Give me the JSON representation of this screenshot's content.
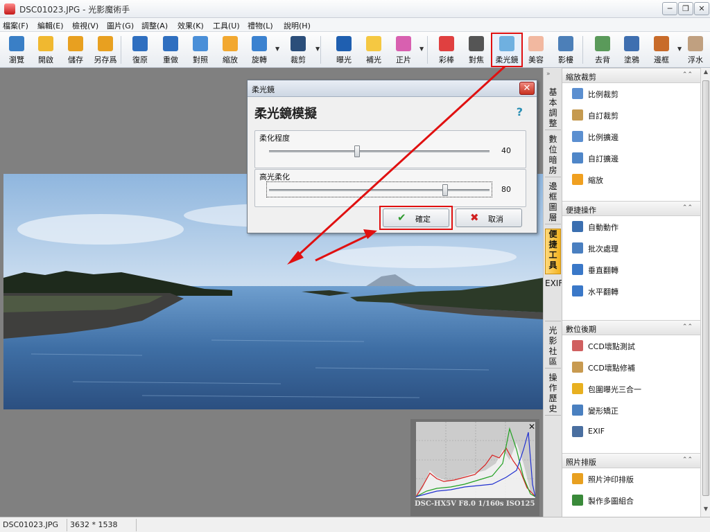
{
  "window": {
    "title": "DSC01023.JPG - 光影魔術手",
    "controls": {
      "minimize": "─",
      "maximize": "❐",
      "close": "✕"
    }
  },
  "menubar": {
    "items": [
      {
        "label": "檔案(F)"
      },
      {
        "label": "編輯(E)"
      },
      {
        "label": "檢視(V)"
      },
      {
        "label": "圖片(G)"
      },
      {
        "label": "調整(A)"
      },
      {
        "label": "效果(K)"
      },
      {
        "label": "工具(U)"
      },
      {
        "label": "禮物(L)"
      },
      {
        "label": "說明(H)"
      }
    ]
  },
  "toolbar": {
    "tools": [
      {
        "label": "瀏覽",
        "icon": "eye-icon",
        "color": "#3a7fc6"
      },
      {
        "label": "開啟",
        "icon": "folder-icon",
        "color": "#f0b830"
      },
      {
        "label": "儲存",
        "icon": "save-icon",
        "color": "#e8a020"
      },
      {
        "label": "另存爲",
        "icon": "save-as-icon",
        "color": "#e8a020"
      },
      {
        "label": "復原",
        "icon": "undo-icon",
        "color": "#2f6fc0"
      },
      {
        "label": "重做",
        "icon": "redo-icon",
        "color": "#2f6fc0"
      },
      {
        "label": "對照",
        "icon": "compare-icon",
        "color": "#4a8fd8"
      },
      {
        "label": "縮放",
        "icon": "resize-icon",
        "color": "#f2a830"
      },
      {
        "label": "旋轉",
        "icon": "rotate-icon",
        "color": "#3b82d0"
      },
      {
        "label": "裁剪",
        "icon": "crop-icon",
        "color": "#2b4e7a"
      },
      {
        "label": "曝光",
        "icon": "exposure-icon",
        "color": "#1f5fb0"
      },
      {
        "label": "補光",
        "icon": "fill-light-icon",
        "color": "#f5c842"
      },
      {
        "label": "正片",
        "icon": "positive-film-icon",
        "color": "#d860b0"
      },
      {
        "label": "彩棒",
        "icon": "color-wand-icon",
        "color": "#e04040"
      },
      {
        "label": "對焦",
        "icon": "focus-icon",
        "color": "#555555"
      },
      {
        "label": "柔光鏡",
        "icon": "soft-focus-icon",
        "color": "#6fb0e0"
      },
      {
        "label": "美容",
        "icon": "beauty-icon",
        "color": "#f2b8a0"
      },
      {
        "label": "影樓",
        "icon": "studio-icon",
        "color": "#4c7fb8"
      },
      {
        "label": "去背",
        "icon": "remove-bg-icon",
        "color": "#5a9a5a"
      },
      {
        "label": "塗鴉",
        "icon": "doodle-icon",
        "color": "#3f6fb0"
      },
      {
        "label": "邊框",
        "icon": "border-icon",
        "color": "#c86b2a"
      },
      {
        "label": "浮水",
        "icon": "watermark-icon",
        "color": "#c0a080"
      }
    ]
  },
  "dialog": {
    "title": "柔光鏡",
    "close": "✕",
    "heading": "柔光鏡模擬",
    "help": "?",
    "sliders": [
      {
        "label": "柔化程度",
        "value": 40,
        "max": 100
      },
      {
        "label": "高光柔化",
        "value": 80,
        "max": 100
      }
    ],
    "ok_label": "確定",
    "ok_icon": "✔",
    "cancel_label": "取消",
    "cancel_icon": "✖"
  },
  "histogram": {
    "caption": "DSC-HX5V  F8.0  1/160s  ISO125",
    "close": "✕"
  },
  "dock_tabs": [
    {
      "label": "基本調整"
    },
    {
      "label": "數位暗房"
    },
    {
      "label": "邊框圖層"
    },
    {
      "label": "便捷工具"
    },
    {
      "label": "EXIF"
    },
    {
      "label": "光影社區"
    },
    {
      "label": "操作歷史"
    }
  ],
  "dock_grip": "»",
  "panel": {
    "sections": [
      {
        "title": "縮放裁剪",
        "collapse": "⌃⌃",
        "items": [
          {
            "label": "比例裁剪",
            "icon": "ratio-crop-icon",
            "color": "#5b8fd0"
          },
          {
            "label": "自訂裁剪",
            "icon": "custom-crop-icon",
            "color": "#c59a50"
          },
          {
            "label": "比例擴邊",
            "icon": "ratio-expand-icon",
            "color": "#5b8fd0"
          },
          {
            "label": "自訂擴邊",
            "icon": "custom-expand-icon",
            "color": "#4f86c8"
          },
          {
            "label": "縮放",
            "icon": "scale-icon",
            "color": "#f0a020"
          }
        ]
      },
      {
        "title": "便捷操作",
        "collapse": "⌃⌃",
        "items": [
          {
            "label": "自動動作",
            "icon": "auto-action-icon",
            "color": "#3b6fb0"
          },
          {
            "label": "批次處理",
            "icon": "batch-icon",
            "color": "#4a7fc0"
          },
          {
            "label": "垂直翻轉",
            "icon": "flip-vertical-icon",
            "color": "#3a78c8"
          },
          {
            "label": "水平翻轉",
            "icon": "flip-horizontal-icon",
            "color": "#3a78c8"
          }
        ]
      },
      {
        "title": "數位後期",
        "collapse": "⌃⌃",
        "items": [
          {
            "label": "CCD壞點測試",
            "icon": "ccd-test-icon",
            "color": "#d06060"
          },
          {
            "label": "CCD壞點修補",
            "icon": "ccd-fix-icon",
            "color": "#c89a50"
          },
          {
            "label": "包圍曝光三合一",
            "icon": "bracket-exposure-icon",
            "color": "#e8b020"
          },
          {
            "label": "變形矯正",
            "icon": "distortion-icon",
            "color": "#4a80c0"
          },
          {
            "label": "EXIF",
            "icon": "exif-icon",
            "color": "#4a6fa0"
          }
        ]
      },
      {
        "title": "照片排版",
        "collapse": "⌃⌃",
        "items": [
          {
            "label": "照片沖印排版",
            "icon": "print-layout-icon",
            "color": "#e8a020"
          },
          {
            "label": "製作多圖組合",
            "icon": "multi-photo-icon",
            "color": "#3a8a3a"
          }
        ]
      }
    ]
  },
  "scrollbar": {
    "up": "▲",
    "down": "▼"
  },
  "statusbar": {
    "filename": "DSC01023.JPG",
    "dimensions": "3632 * 1538"
  },
  "colors": {
    "highlight": "#e01010",
    "canvas": "#808080",
    "active_tab": "#f3b21f"
  }
}
